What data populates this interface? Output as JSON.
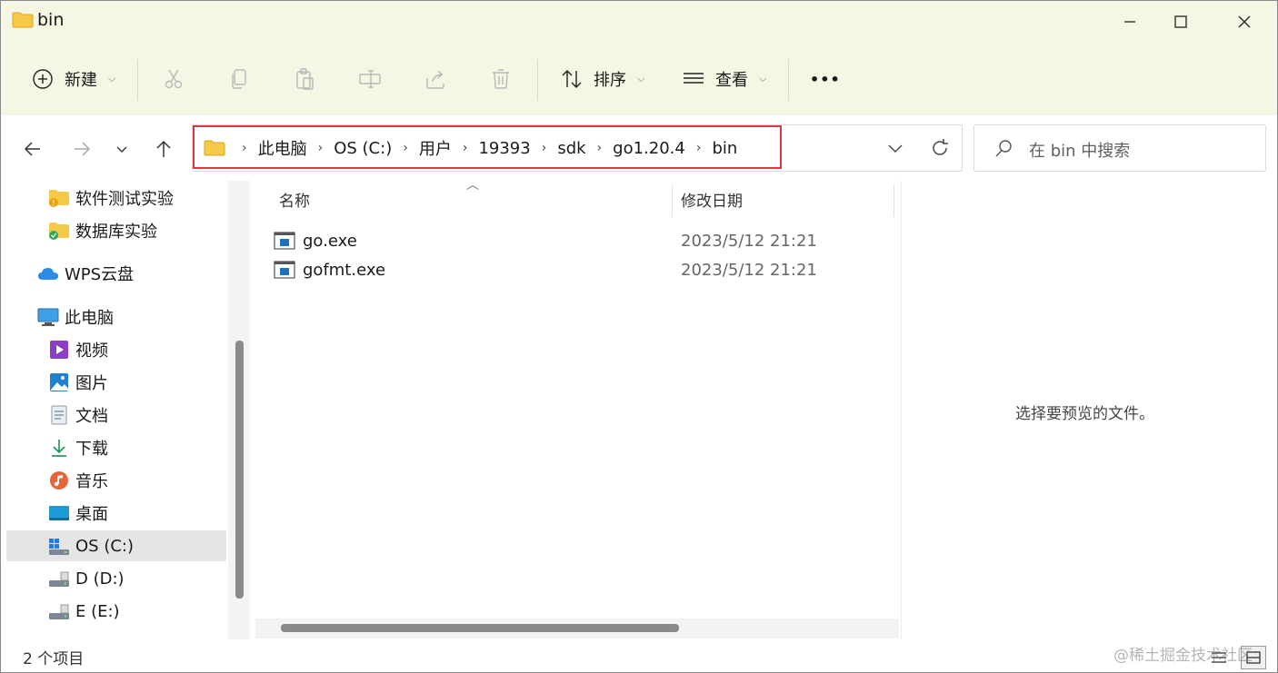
{
  "window": {
    "title": "bin"
  },
  "toolbar": {
    "new_label": "新建",
    "sort_label": "排序",
    "view_label": "查看",
    "more_label": "•••"
  },
  "address": {
    "crumbs": [
      "此电脑",
      "OS (C:)",
      "用户",
      "19393",
      "sdk",
      "go1.20.4",
      "bin"
    ]
  },
  "search": {
    "placeholder": "在 bin 中搜索"
  },
  "sidebar": {
    "items": [
      {
        "label": "软件测试实验",
        "icon": "folder-warning-icon"
      },
      {
        "label": "数据库实验",
        "icon": "folder-synced-icon"
      },
      {
        "label": "WPS云盘",
        "icon": "cloud-icon"
      },
      {
        "label": "此电脑",
        "icon": "computer-icon"
      },
      {
        "label": "视频",
        "icon": "video-icon"
      },
      {
        "label": "图片",
        "icon": "pictures-icon"
      },
      {
        "label": "文档",
        "icon": "documents-icon"
      },
      {
        "label": "下载",
        "icon": "download-icon"
      },
      {
        "label": "音乐",
        "icon": "music-icon"
      },
      {
        "label": "桌面",
        "icon": "desktop-icon"
      },
      {
        "label": "OS (C:)",
        "icon": "windows-drive-icon"
      },
      {
        "label": "D (D:)",
        "icon": "drive-icon"
      },
      {
        "label": "E (E:)",
        "icon": "drive-icon"
      }
    ]
  },
  "filelist": {
    "columns": {
      "name": "名称",
      "date": "修改日期"
    },
    "rows": [
      {
        "name": "go.exe",
        "date": "2023/5/12 21:21"
      },
      {
        "name": "gofmt.exe",
        "date": "2023/5/12 21:21"
      }
    ]
  },
  "preview": {
    "empty_text": "选择要预览的文件。"
  },
  "status": {
    "count": "2 个项目"
  },
  "watermark": "@稀土掘金技术社区",
  "colors": {
    "highlight": "#d6393f",
    "folder": "#f7c948",
    "toolbar_bg": "#f5f6e3"
  }
}
